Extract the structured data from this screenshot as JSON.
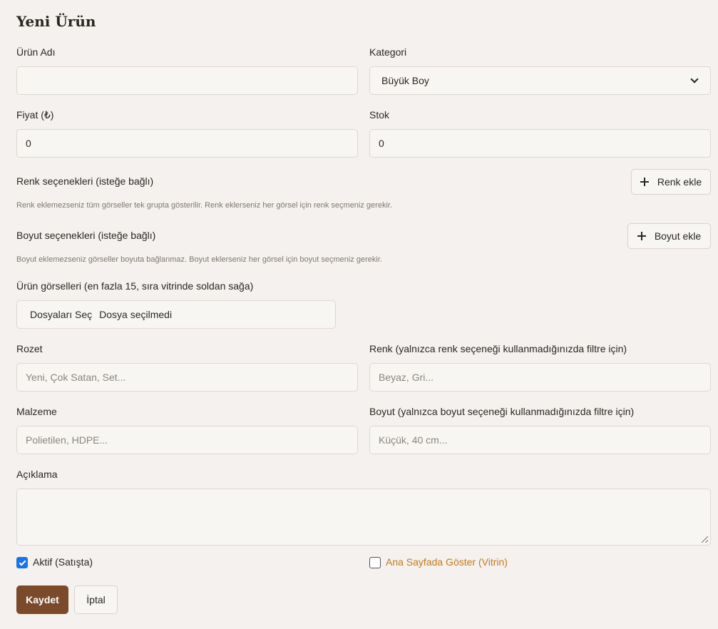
{
  "page": {
    "title": "Yeni Ürün"
  },
  "form": {
    "name": {
      "label": "Ürün Adı",
      "value": "",
      "placeholder": ""
    },
    "category": {
      "label": "Kategori",
      "selected": "Büyük Boy"
    },
    "price": {
      "label": "Fiyat (₺)",
      "value": "0"
    },
    "stock": {
      "label": "Stok",
      "value": "0"
    },
    "color_options": {
      "label": "Renk seçenekleri (isteğe bağlı)",
      "add_label": "Renk ekle",
      "help": "Renk eklemezseniz tüm görseller tek grupta gösterilir. Renk eklerseniz her görsel için renk seçmeniz gerekir."
    },
    "size_options": {
      "label": "Boyut seçenekleri (isteğe bağlı)",
      "add_label": "Boyut ekle",
      "help": "Boyut eklemezseniz görseller boyuta bağlanmaz. Boyut eklerseniz her görsel için boyut seçmeniz gerekir."
    },
    "images": {
      "label": "Ürün görselleri (en fazla 15, sıra vitrinde soldan sağa)",
      "button": "Dosyaları Seç",
      "status": "Dosya seçilmedi"
    },
    "badge": {
      "label": "Rozet",
      "placeholder": "Yeni, Çok Satan, Set..."
    },
    "color": {
      "label": "Renk (yalnızca renk seçeneği kullanmadığınızda filtre için)",
      "placeholder": "Beyaz, Gri..."
    },
    "material": {
      "label": "Malzeme",
      "placeholder": "Polietilen, HDPE..."
    },
    "size": {
      "label": "Boyut (yalnızca boyut seçeneği kullanmadığınızda filtre için)",
      "placeholder": "Küçük, 40 cm..."
    },
    "description": {
      "label": "Açıklama",
      "value": ""
    },
    "active": {
      "label": "Aktif (Satışta)",
      "checked": true
    },
    "showcase": {
      "label": "Ana Sayfada Göster (Vitrin)",
      "checked": false,
      "color": "#c47a1a"
    }
  },
  "actions": {
    "save": "Kaydet",
    "cancel": "İptal"
  },
  "colors": {
    "primary": "#7a4a2a",
    "checkbox": "#1a73e8",
    "background": "#f4f1ee"
  }
}
